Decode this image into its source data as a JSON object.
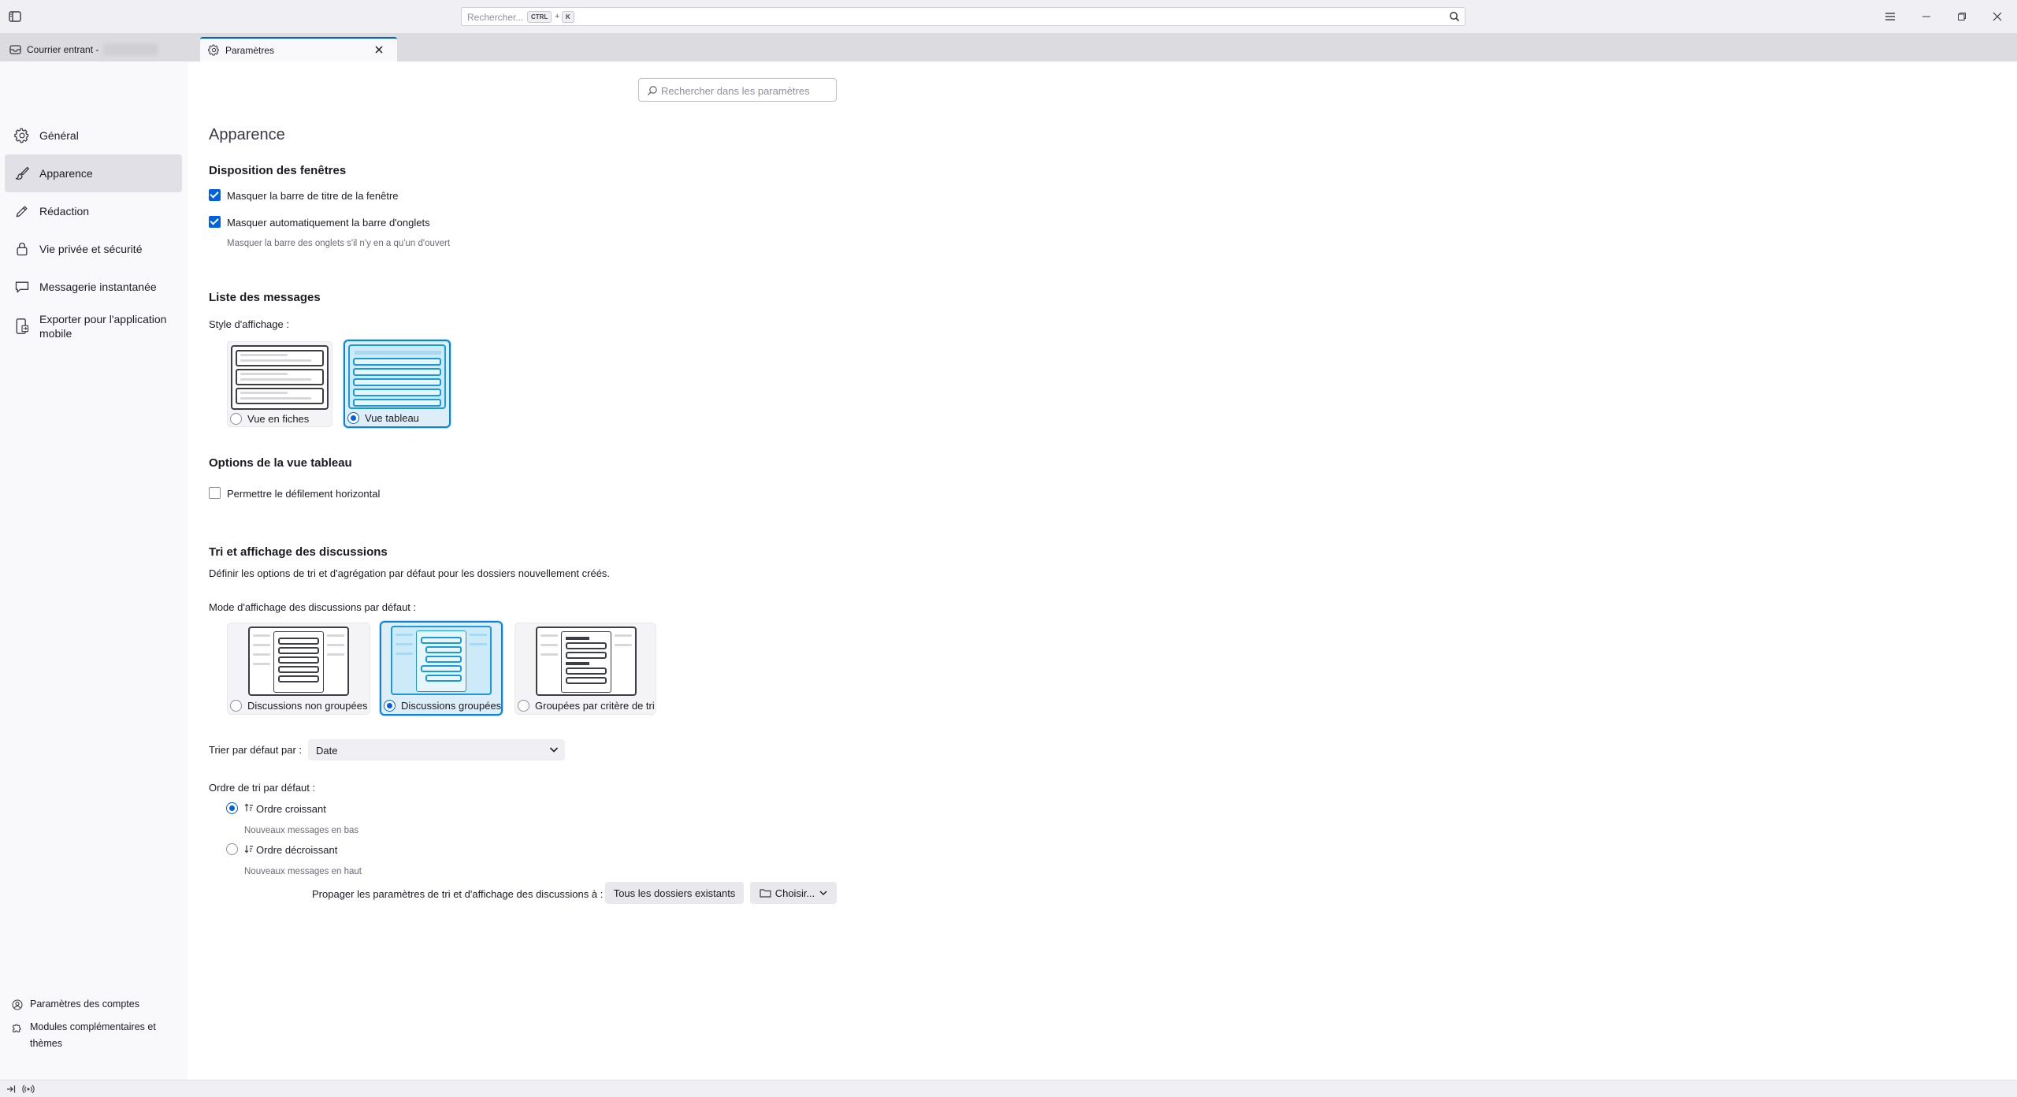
{
  "titlebar": {
    "search_placeholder": "Rechercher...",
    "shortcut_ctrl": "CTRL",
    "shortcut_plus": "+",
    "shortcut_key": "K"
  },
  "tabs": [
    {
      "label": "Courrier entrant -",
      "active": false
    },
    {
      "label": "Paramètres",
      "active": true
    }
  ],
  "sidebar": {
    "items": [
      {
        "label": "Général",
        "icon": "gear-icon"
      },
      {
        "label": "Apparence",
        "icon": "brush-icon",
        "selected": true
      },
      {
        "label": "Rédaction",
        "icon": "pencil-icon"
      },
      {
        "label": "Vie privée et sécurité",
        "icon": "lock-icon"
      },
      {
        "label": "Messagerie instantanée",
        "icon": "chat-icon"
      },
      {
        "label": "Exporter pour l'application mobile",
        "icon": "mobile-export-icon"
      }
    ],
    "footer": [
      {
        "label": "Paramètres des comptes",
        "icon": "account-settings-icon"
      },
      {
        "label": "Modules complémentaires et thèmes",
        "icon": "puzzle-icon"
      }
    ]
  },
  "main": {
    "search_placeholder": "Rechercher dans les paramètres",
    "page_title": "Apparence",
    "window_layout": {
      "heading": "Disposition des fenêtres",
      "hide_titlebar": {
        "label": "Masquer la barre de titre de la fenêtre",
        "checked": true
      },
      "autohide_tabbar": {
        "label": "Masquer automatiquement la barre d'onglets",
        "checked": true,
        "hint": "Masquer la barre des onglets s'il n'y en a qu'un d'ouvert"
      }
    },
    "message_list": {
      "heading": "Liste des messages",
      "style_label": "Style d'affichage :",
      "options": [
        {
          "label": "Vue en fiches",
          "selected": false
        },
        {
          "label": "Vue tableau",
          "selected": true
        }
      ]
    },
    "table_options": {
      "heading": "Options de la vue tableau",
      "horizontal_scroll": {
        "label": "Permettre le défilement horizontal",
        "checked": false
      }
    },
    "threads": {
      "heading": "Tri et affichage des discussions",
      "description": "Définir les options de tri et d'agrégation par défaut pour les dossiers nouvellement créés.",
      "mode_label": "Mode d'affichage des discussions par défaut :",
      "modes": [
        {
          "label": "Discussions non groupées",
          "selected": false
        },
        {
          "label": "Discussions groupées",
          "selected": true
        },
        {
          "label": "Groupées par critère de tri",
          "selected": false
        }
      ],
      "sort_by_label": "Trier par défaut par :",
      "sort_by_value": "Date",
      "sort_order_label": "Ordre de tri par défaut :",
      "orders": [
        {
          "label": "Ordre croissant",
          "hint": "Nouveaux messages en bas",
          "selected": true
        },
        {
          "label": "Ordre décroissant",
          "hint": "Nouveaux messages en haut",
          "selected": false
        }
      ],
      "propagate_label": "Propager les paramètres de tri et d'affichage des discussions à :",
      "all_folders_button": "Tous les dossiers existants",
      "choose_button": "Choisir..."
    }
  },
  "colors": {
    "accent": "#0061e0",
    "selected_card": "#0a84d6"
  }
}
